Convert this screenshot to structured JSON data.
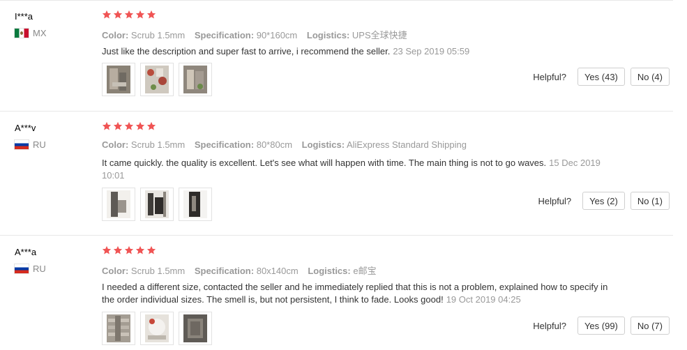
{
  "labels": {
    "color": "Color:",
    "specification": "Specification:",
    "logistics": "Logistics:",
    "helpful": "Helpful?"
  },
  "colors": {
    "star": "#f05454",
    "muted": "#999999",
    "divider": "#e8e8e8"
  },
  "reviews": [
    {
      "user": "I***a",
      "flag_icon": "mexico-flag-icon",
      "country": "MX",
      "rating": 5,
      "color": "Scrub 1.5mm",
      "specification": "90*160cm",
      "logistics": "UPS全球快捷",
      "text": "Just like the description and super fast to arrive, i recommend the seller.",
      "date": "23 Sep 2019 05:59",
      "photos": [
        "review-photo",
        "review-photo",
        "review-photo"
      ],
      "yes": "Yes (43)",
      "no": "No (4)"
    },
    {
      "user": "A***v",
      "flag_icon": "russia-flag-icon",
      "country": "RU",
      "rating": 5,
      "color": "Scrub 1.5mm",
      "specification": "80*80cm",
      "logistics": "AliExpress Standard Shipping",
      "text": "It came quickly. the quality is excellent. Let's see what will happen with time. The main thing is not to go waves.",
      "date": "15 Dec 2019 10:01",
      "photos": [
        "review-photo",
        "review-photo",
        "review-photo"
      ],
      "yes": "Yes (2)",
      "no": "No (1)"
    },
    {
      "user": "A***a",
      "flag_icon": "russia-flag-icon",
      "country": "RU",
      "rating": 5,
      "color": "Scrub 1.5mm",
      "specification": "80x140cm",
      "logistics": "e邮宝",
      "text": "I needed a different size, contacted the seller and he immediately replied that this is not a problem, explained how to specify in the order individual sizes. The smell is, but not persistent, I think to fade. Looks good!",
      "date": "19 Oct 2019 04:25",
      "photos": [
        "review-photo",
        "review-photo",
        "review-photo"
      ],
      "yes": "Yes (99)",
      "no": "No (7)"
    }
  ]
}
